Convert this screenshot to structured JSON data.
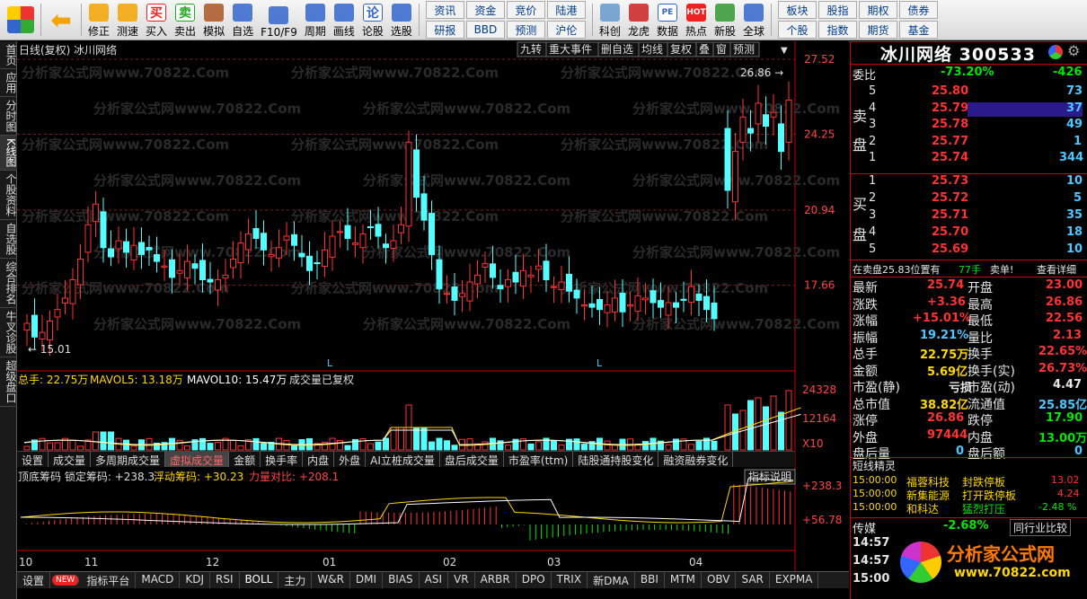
{
  "toolbar": {
    "buttons": [
      {
        "label": "修正",
        "icon": "up-arrow-icon"
      },
      {
        "label": "测速",
        "icon": "clock-icon"
      },
      {
        "label": "买入",
        "icon": "buy-icon",
        "glyph": "买"
      },
      {
        "label": "卖出",
        "icon": "sell-icon",
        "glyph": "卖"
      },
      {
        "label": "模拟",
        "icon": "gavel-icon"
      },
      {
        "label": "自选",
        "icon": "star-icon"
      },
      {
        "label": "F10/F9",
        "icon": "f10-icon"
      },
      {
        "label": "周期",
        "icon": "period-icon"
      },
      {
        "label": "画线",
        "icon": "pen-icon"
      },
      {
        "label": "论股",
        "icon": "chat-icon",
        "glyph": "论"
      },
      {
        "label": "选股",
        "icon": "select-icon"
      }
    ],
    "grid": [
      "资讯",
      "研报",
      "资金",
      "BBD",
      "竞价",
      "预测",
      "陆港",
      "沪伦"
    ],
    "buttons2": [
      {
        "label": "科创",
        "icon": "kechuang-icon"
      },
      {
        "label": "龙虎",
        "icon": "dragon-icon"
      },
      {
        "label": "数据",
        "icon": "data-icon",
        "glyph": "PE"
      },
      {
        "label": "热点",
        "icon": "hot-icon",
        "glyph": "HOT"
      },
      {
        "label": "新股",
        "icon": "ipo-icon"
      },
      {
        "label": "全球",
        "icon": "globe-icon"
      }
    ],
    "grid2": [
      "板块",
      "个股",
      "股指",
      "指数",
      "期权",
      "期货",
      "债券",
      "基金"
    ]
  },
  "left_nav": [
    "首页",
    "应用",
    "分时图",
    "K线图",
    "个股资料",
    "自选股",
    "综合排名",
    "牛叉诊股",
    "超级盘口"
  ],
  "chart": {
    "title": "日线(复权) 冰川网络",
    "watermark": "分析家公式网www.70822.Com",
    "top_tabs": [
      "九转",
      "重大事件",
      "删自选",
      "均线",
      "复权",
      "叠",
      "窗",
      "预测"
    ],
    "price_ticks": [
      "27.52",
      "24.25",
      "20.94",
      "17.66"
    ],
    "high_label": "26.86",
    "low_label": "15.01",
    "vol_legend": {
      "a": "总手: 22.75万",
      "b": "MAVOL5: 13.18万",
      "c": "MAVOL10: 15.47万",
      "d": "成交量已复权"
    },
    "vol_ticks": [
      "24328",
      "12164",
      "X10"
    ],
    "ind_tabs": [
      "设置",
      "成交量",
      "多周期成交量",
      "虚拟成交量",
      "金额",
      "换手率",
      "内盘",
      "外盘",
      "AI立桩成交量",
      "盘后成交量",
      "市盈率(ttm)",
      "陆股通持股变化",
      "融资融券变化"
    ],
    "chip_legend": {
      "a": "顶底筹码 锁定筹码: +238.3",
      "b": "浮动筹码: +30.23",
      "c": "力量对比: +208.1"
    },
    "chip_button": "指标说明",
    "chip_ticks": [
      "+238.3",
      "+56.78"
    ],
    "months": [
      "10",
      "11",
      "12",
      "01",
      "02",
      "03",
      "04"
    ],
    "marker": "L"
  },
  "bottom_tabs": [
    "设置",
    "NEW",
    "指标平台",
    "MACD",
    "KDJ",
    "RSI",
    "BOLL",
    "主力",
    "W&R",
    "DMI",
    "BIAS",
    "ASI",
    "VR",
    "ARBR",
    "DPO",
    "TRIX",
    "新DMA",
    "BBI",
    "MTM",
    "OBV",
    "SAR",
    "EXPMA"
  ],
  "right_panel": {
    "name": "冰川网络 300533",
    "weibi_label": "委比",
    "weibi": "-73.20%",
    "weicha": "-426",
    "sell_label": "卖盘",
    "buy_label": "买盘",
    "sells": [
      {
        "lv": "5",
        "p": "25.80",
        "v": "73"
      },
      {
        "lv": "4",
        "p": "25.79",
        "v": "37"
      },
      {
        "lv": "3",
        "p": "25.78",
        "v": "49"
      },
      {
        "lv": "2",
        "p": "25.77",
        "v": "1"
      },
      {
        "lv": "1",
        "p": "25.74",
        "v": "344"
      }
    ],
    "buys": [
      {
        "lv": "1",
        "p": "25.73",
        "v": "10"
      },
      {
        "lv": "2",
        "p": "25.72",
        "v": "5"
      },
      {
        "lv": "3",
        "p": "25.71",
        "v": "35"
      },
      {
        "lv": "4",
        "p": "25.70",
        "v": "18"
      },
      {
        "lv": "5",
        "p": "25.69",
        "v": "10"
      }
    ],
    "sell_strip": {
      "a": "在卖盘25.83位置有",
      "b": "77手",
      "c": "卖单!",
      "d": "查看详细"
    },
    "quotes": [
      [
        "最新",
        "25.74",
        "开盘",
        "23.00"
      ],
      [
        "涨跌",
        "+3.36",
        "最高",
        "26.86"
      ],
      [
        "涨幅",
        "+15.01%",
        "最低",
        "22.56"
      ],
      [
        "振幅",
        "19.21%",
        "量比",
        "2.13"
      ],
      [
        "总手",
        "22.75万",
        "换手",
        "22.65%"
      ],
      [
        "金额",
        "5.69亿",
        "换手(实)",
        "26.73%"
      ],
      [
        "市盈(静)",
        "亏损",
        "市盈(动)",
        "4.47"
      ],
      [
        "总市值",
        "38.82亿",
        "流通值",
        "25.85亿"
      ],
      [
        "涨停",
        "26.86",
        "跌停",
        "17.90"
      ],
      [
        "外盘",
        "97444",
        "内盘",
        "13.00万"
      ],
      [
        "盘后量",
        "0",
        "盘后额",
        "0"
      ]
    ],
    "elf_title": "短线精灵",
    "elf": [
      {
        "t": "15:00:00",
        "s": "福蓉科技",
        "e": "封跌停板",
        "v": "13.02"
      },
      {
        "t": "15:00:00",
        "s": "新集能源",
        "e": "打开跌停板",
        "v": "4.24"
      },
      {
        "t": "15:00:00",
        "s": "和科达",
        "e": "猛烈打压",
        "v": "-2.48 %"
      }
    ],
    "sector": {
      "name": "传媒",
      "chg": "-2.68%",
      "btn": "同行业比较"
    },
    "ticks": [
      "14:57",
      "14:57",
      "15:00"
    ],
    "logo": {
      "main": "分析家公式网",
      "url": "www.70822.com"
    }
  }
}
